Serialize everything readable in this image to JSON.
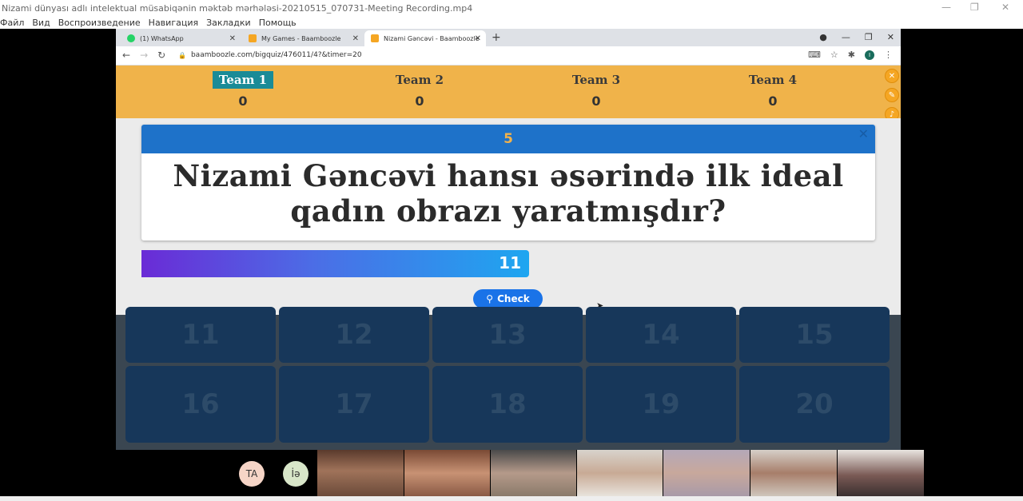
{
  "outer_window": {
    "title": "Nizami dünyası adlı intelektual müsabiqənin məktəb mərhələsi-20210515_070731-Meeting Recording.mp4",
    "menu": [
      "Файл",
      "Вид",
      "Воспроизведение",
      "Навигация",
      "Закладки",
      "Помощь"
    ]
  },
  "browser": {
    "tabs": [
      {
        "label": "(1) WhatsApp",
        "favicon_color": "#25d366",
        "active": false
      },
      {
        "label": "My Games - Baamboozle",
        "favicon_color": "#f5a623",
        "active": false
      },
      {
        "label": "Nizami Gəncəvi - Baamboozle",
        "favicon_color": "#f5a623",
        "active": true
      }
    ],
    "url": "baamboozle.com/bigquiz/476011/4?&timer=20",
    "profile_initial": "I"
  },
  "game": {
    "teams": [
      {
        "name": "Team 1",
        "score": "0",
        "active": true
      },
      {
        "name": "Team 2",
        "score": "0",
        "active": false
      },
      {
        "name": "Team 3",
        "score": "0",
        "active": false
      },
      {
        "name": "Team 4",
        "score": "0",
        "active": false
      }
    ],
    "question": {
      "number": "5",
      "text": "Nizami Gəncəvi hansı əsərində ilk ideal qadın obrazı yaratmışdır?"
    },
    "timer": {
      "value": "11"
    },
    "check_label": "Check",
    "tiles": [
      "11",
      "12",
      "13",
      "14",
      "15",
      "16",
      "17",
      "18",
      "19",
      "20"
    ]
  },
  "participants": {
    "avatars": [
      "TA",
      "İə"
    ]
  },
  "colors": {
    "team_bar": "#f0b34a",
    "active_team": "#1a8b97",
    "question_header": "#1e72c9",
    "check_button": "#1a73e8"
  }
}
